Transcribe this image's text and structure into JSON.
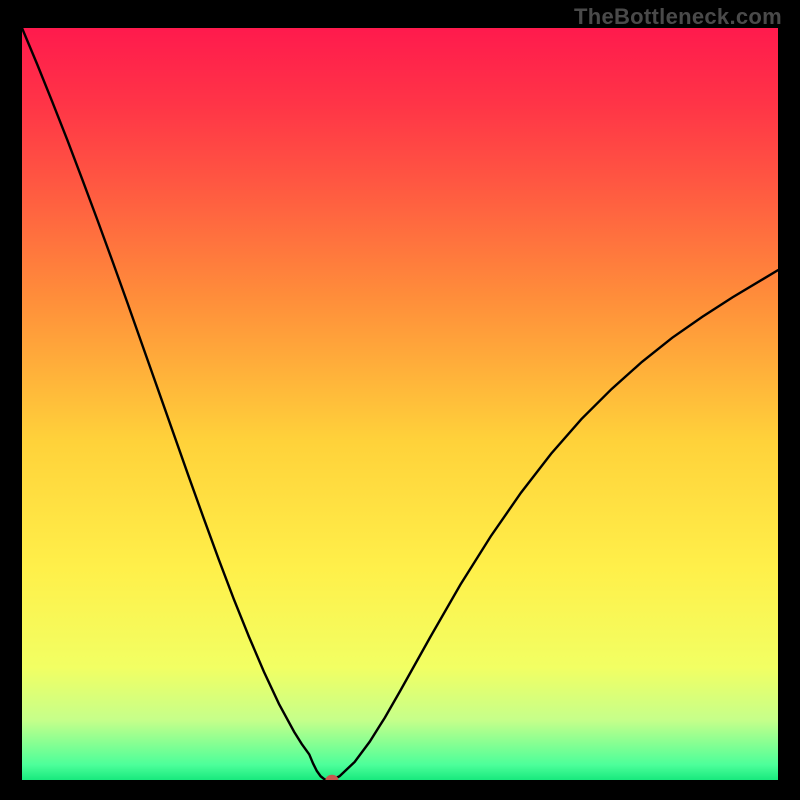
{
  "watermark": "TheBottleneck.com",
  "colors": {
    "page_bg": "#000000",
    "curve_stroke": "#000000",
    "marker_fill": "#c85a4f",
    "gradient_stops": [
      {
        "offset": 0.0,
        "color": "#ff1a4d"
      },
      {
        "offset": 0.1,
        "color": "#ff3447"
      },
      {
        "offset": 0.2,
        "color": "#ff5542"
      },
      {
        "offset": 0.36,
        "color": "#ff8e3a"
      },
      {
        "offset": 0.55,
        "color": "#ffd23a"
      },
      {
        "offset": 0.72,
        "color": "#fff04a"
      },
      {
        "offset": 0.85,
        "color": "#f2ff63"
      },
      {
        "offset": 0.92,
        "color": "#c6ff8a"
      },
      {
        "offset": 0.98,
        "color": "#4cff9a"
      },
      {
        "offset": 1.0,
        "color": "#18e97d"
      }
    ]
  },
  "chart_data": {
    "type": "line",
    "title": "",
    "xlabel": "",
    "ylabel": "",
    "xlim": [
      0,
      100
    ],
    "ylim": [
      0,
      100
    ],
    "grid": false,
    "legend": false,
    "x": [
      0,
      2,
      4,
      6,
      8,
      10,
      12,
      14,
      16,
      18,
      20,
      22,
      24,
      26,
      28,
      30,
      32,
      34,
      36,
      37,
      38,
      38.5,
      39,
      39.5,
      40,
      40.5,
      41,
      42,
      44,
      46,
      48,
      50,
      54,
      58,
      62,
      66,
      70,
      74,
      78,
      82,
      86,
      90,
      94,
      98,
      100
    ],
    "y": [
      100,
      95.2,
      90.2,
      85.1,
      79.8,
      74.4,
      68.9,
      63.3,
      57.6,
      51.9,
      46.2,
      40.5,
      34.9,
      29.4,
      24.1,
      19.1,
      14.4,
      10.1,
      6.4,
      4.8,
      3.4,
      2.2,
      1.2,
      0.5,
      0.1,
      0.0,
      0.0,
      0.5,
      2.4,
      5.1,
      8.3,
      11.8,
      19.0,
      26.0,
      32.4,
      38.2,
      43.4,
      48.0,
      52.0,
      55.6,
      58.8,
      61.6,
      64.2,
      66.6,
      67.8
    ],
    "marker": {
      "x": 41.0,
      "y": 0.0
    }
  }
}
